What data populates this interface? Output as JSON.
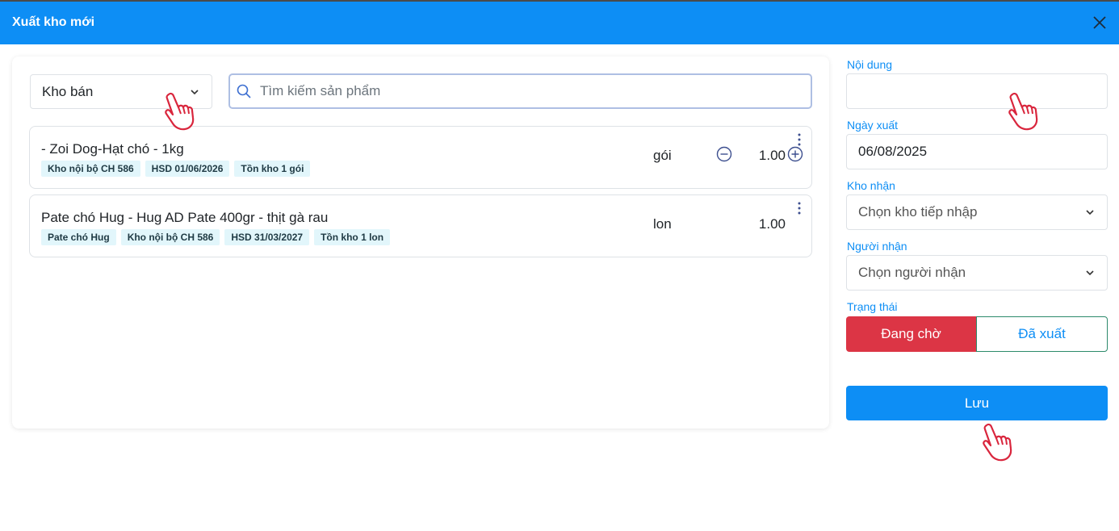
{
  "header": {
    "title": "Xuất kho mới"
  },
  "left": {
    "warehouse_select": {
      "value": "Kho bán"
    },
    "search": {
      "placeholder": "Tìm kiếm sản phẩm"
    },
    "items": [
      {
        "name": "- Zoi Dog-Hạt chó - 1kg",
        "tags": [
          "Kho nội bộ CH 586",
          "HSD 01/06/2026",
          "Tồn kho 1 gói"
        ],
        "unit": "gói",
        "qty": "1.00"
      },
      {
        "name": "Pate chó Hug - Hug AD Pate 400gr - thịt gà rau",
        "tags": [
          "Pate chó Hug",
          "Kho nội bộ CH 586",
          "HSD 31/03/2027",
          "Tồn kho 1 lon"
        ],
        "unit": "lon",
        "qty": "1.00"
      }
    ]
  },
  "form": {
    "content_label": "Nội dung",
    "content_value": "",
    "date_label": "Ngày xuất",
    "date_value": "06/08/2025",
    "receiving_warehouse_label": "Kho nhận",
    "receiving_warehouse_placeholder": "Chọn kho tiếp nhập",
    "receiver_label": "Người nhận",
    "receiver_placeholder": "Chọn người nhận",
    "status_label": "Trạng thái",
    "status_pending": "Đang chờ",
    "status_exported": "Đã xuất",
    "save_label": "Lưu"
  },
  "colors": {
    "header": "#0d8ef5",
    "accent": "#0d8ef5",
    "danger": "#dc3545",
    "hand_pointer": "#d9263d"
  }
}
